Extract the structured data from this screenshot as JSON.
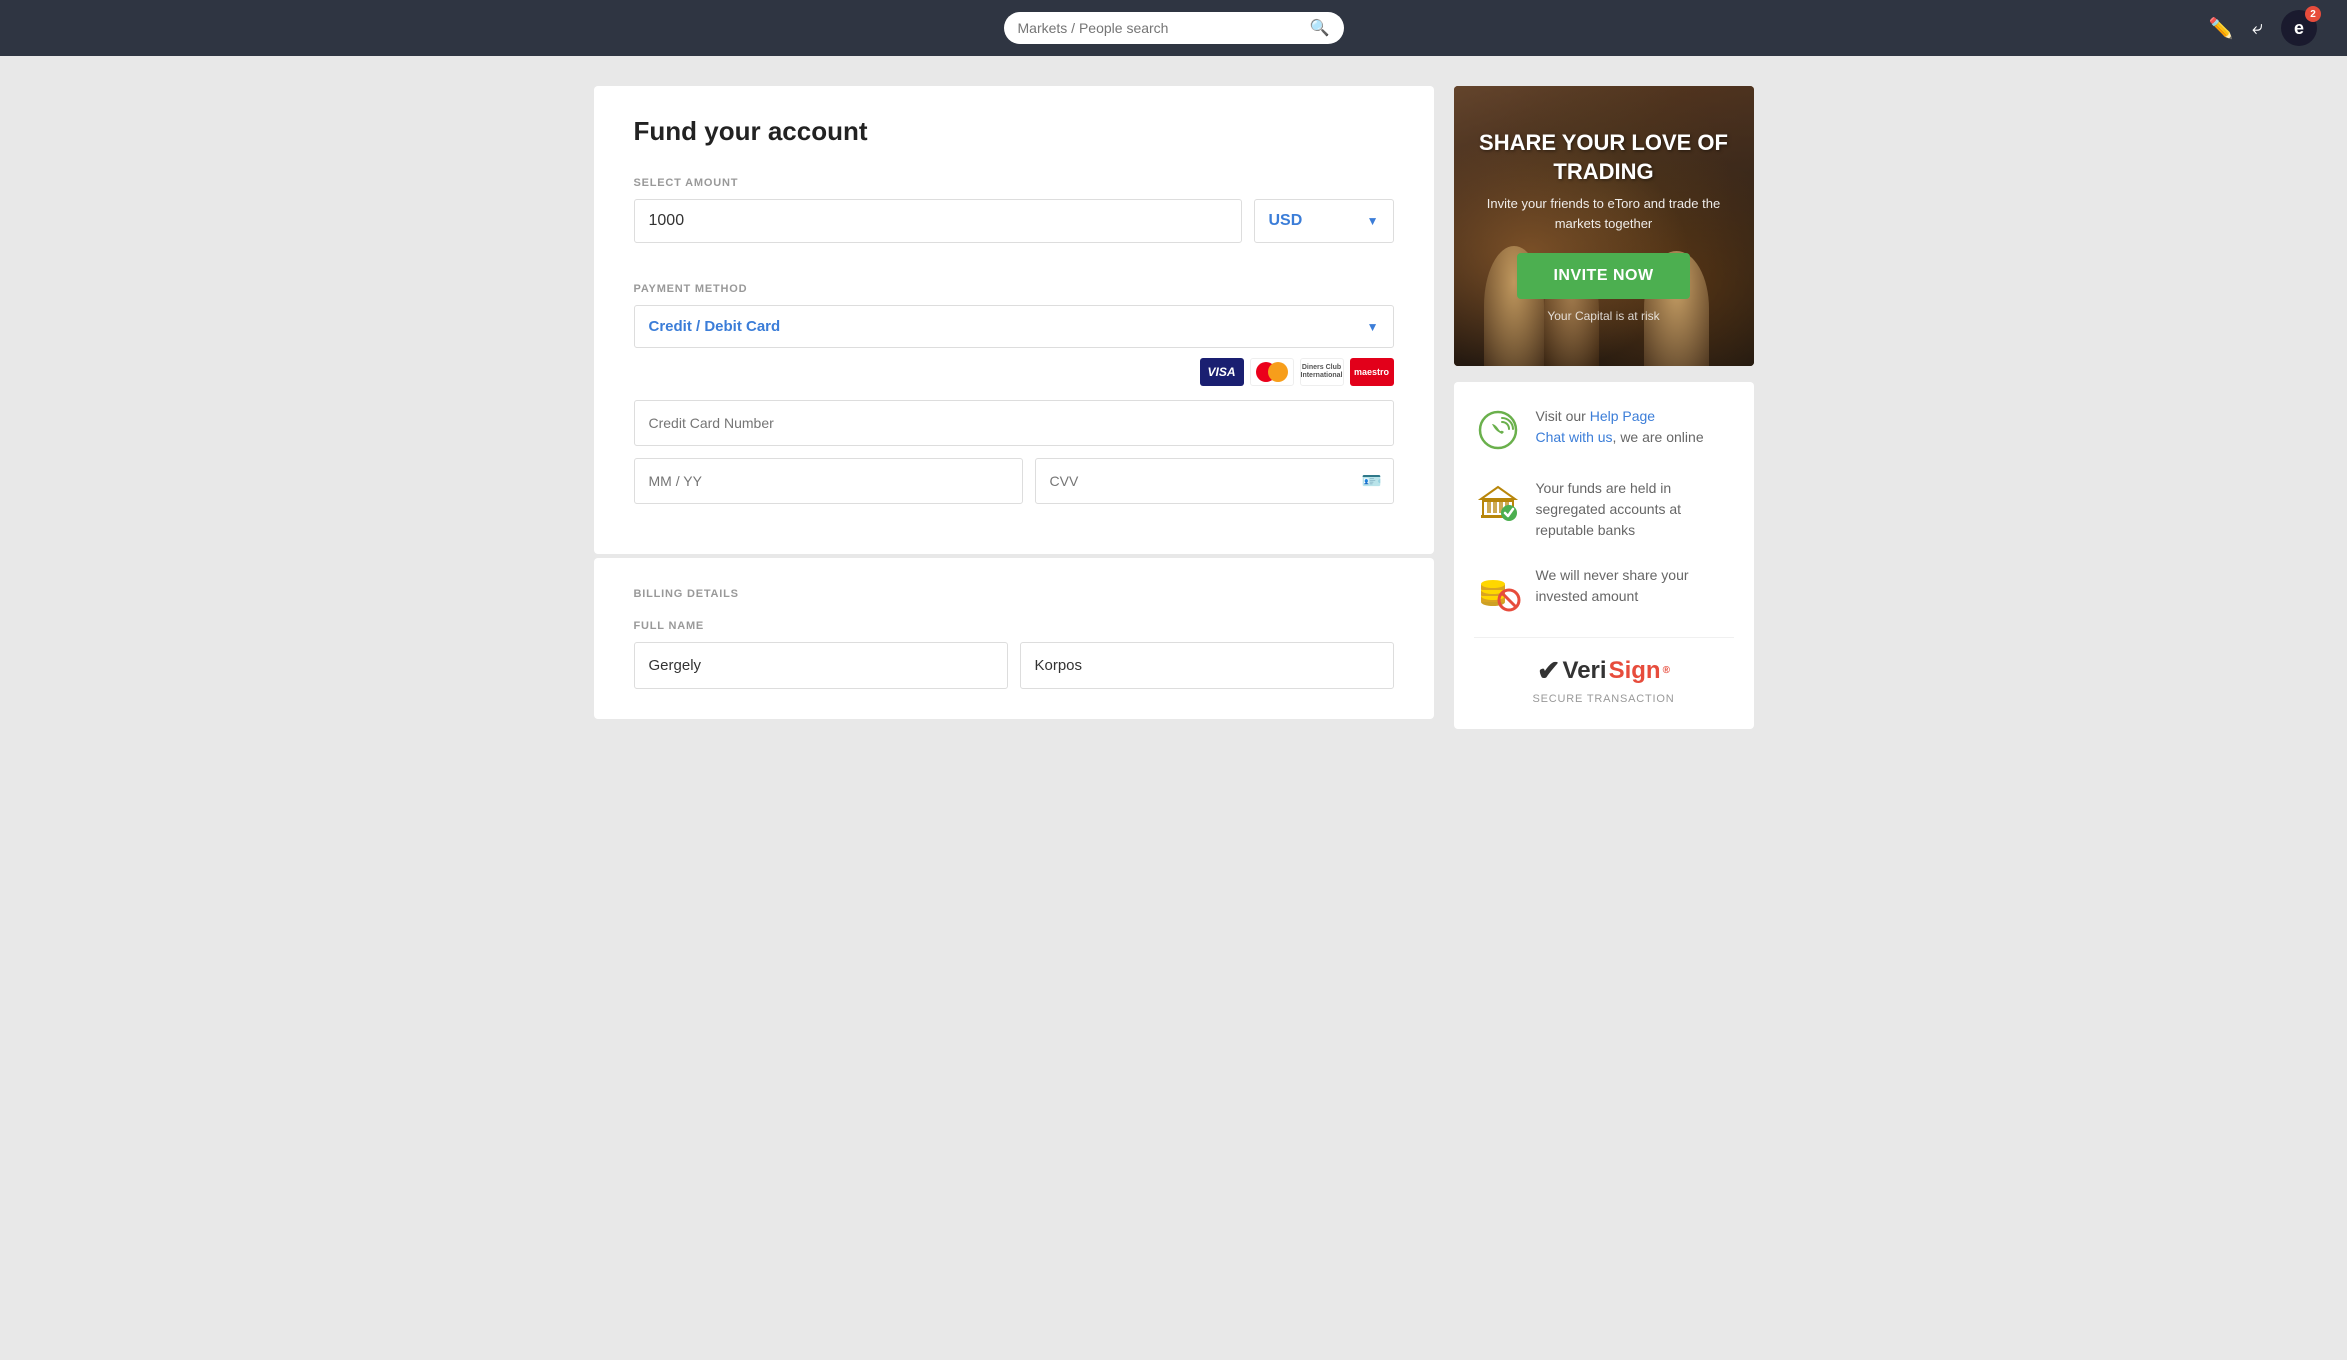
{
  "header": {
    "search_placeholder": "Markets / People search",
    "badge_count": "2",
    "avatar_letter": "e"
  },
  "fund_form": {
    "title": "Fund your account",
    "select_amount_label": "SELECT AMOUNT",
    "amount_value": "1000",
    "currency_value": "USD",
    "payment_method_label": "PAYMENT METHOD",
    "payment_method_value": "Credit / Debit Card",
    "credit_card_placeholder": "Credit Card Number",
    "mm_yy_placeholder": "MM / YY",
    "cvv_placeholder": "CVV"
  },
  "billing": {
    "title": "BILLING DETAILS",
    "full_name_label": "FULL NAME",
    "first_name": "Gergely",
    "last_name": "Korpos"
  },
  "banner": {
    "title": "SHARE YOUR LOVE OF TRADING",
    "subtitle": "Invite your friends to eToro and trade the markets together",
    "invite_button": "INVITE NOW",
    "risk_text": "Your Capital is at risk"
  },
  "info_box": {
    "item1_text_prefix": "Visit our ",
    "item1_link1": "Help Page",
    "item1_text_mid": "\nChat with us",
    "item1_text_suffix": ", we are online",
    "item2_text": "Your funds are held in segregated accounts at reputable banks",
    "item3_text": "We will never share your invested amount",
    "verisign_label": "SECURE TRANSACTION"
  }
}
